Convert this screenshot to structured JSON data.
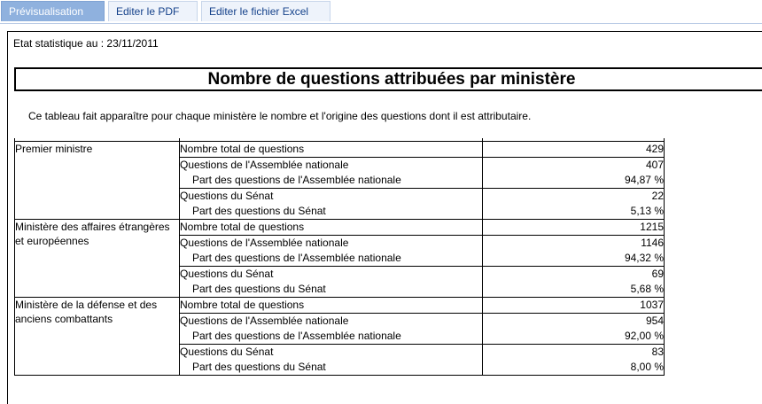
{
  "tabs": [
    {
      "label": "Prévisualisation",
      "active": true
    },
    {
      "label": "Editer le PDF",
      "active": false
    },
    {
      "label": "Editer le fichier Excel",
      "active": false
    }
  ],
  "report": {
    "date_line": "Etat statistique au : 23/11/2011",
    "title": "Nombre de questions attribuées par ministère",
    "description": "Ce tableau fait apparaître pour chaque ministère le nombre et l'origine des questions dont il est attributaire.",
    "labels": {
      "total": "Nombre total de questions",
      "an": "Questions de l'Assemblée nationale",
      "an_share": "Part des questions de l'Assemblée nationale",
      "senat": "Questions du Sénat",
      "senat_share": "Part des questions du Sénat"
    },
    "ministries": [
      {
        "name": "Premier ministre",
        "total": "429",
        "an": "407",
        "an_share": "94,87 %",
        "senat": "22",
        "senat_share": "5,13 %"
      },
      {
        "name": "Ministère des affaires étrangères et européennes",
        "total": "1215",
        "an": "1146",
        "an_share": "94,32 %",
        "senat": "69",
        "senat_share": "5,68 %"
      },
      {
        "name": "Ministère de la défense et des anciens combattants",
        "total": "1037",
        "an": "954",
        "an_share": "92,00 %",
        "senat": "83",
        "senat_share": "8,00 %"
      }
    ]
  },
  "colors": {
    "tab_active_bg": "#8fb1de",
    "tab_text": "#15428b"
  }
}
